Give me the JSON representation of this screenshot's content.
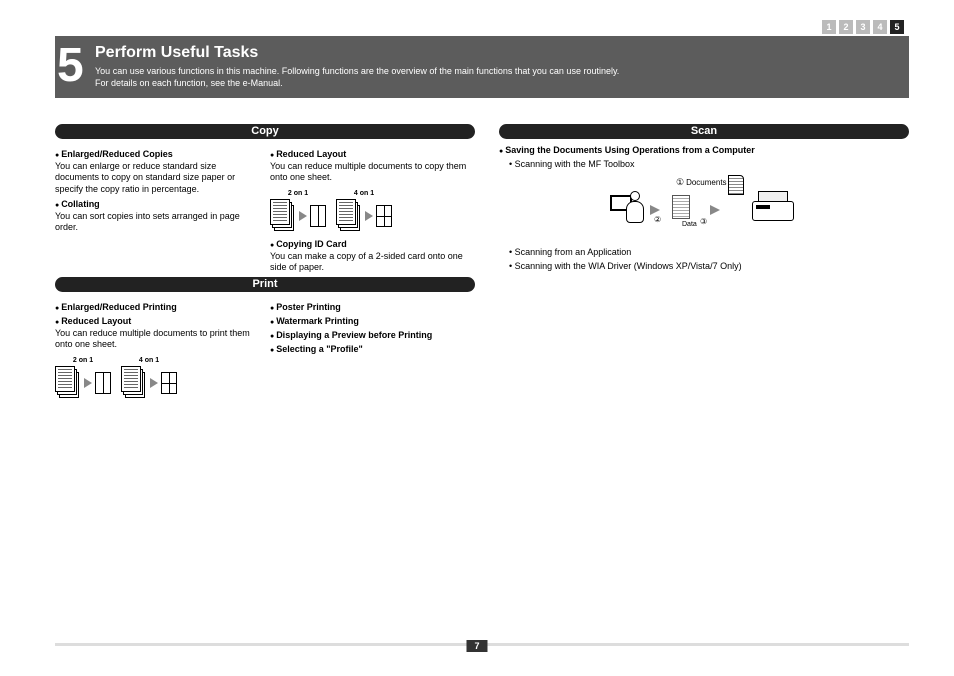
{
  "nav": {
    "pages": [
      "1",
      "2",
      "3",
      "4",
      "5"
    ],
    "active": "5"
  },
  "language": "English",
  "chapter": "5",
  "title": "Perform Useful Tasks",
  "subtitle1": "You can use various functions in this machine. Following functions are the overview of the main functions that you can use routinely.",
  "subtitle2": "For details on each function, see the e-Manual.",
  "copy": {
    "heading": "Copy",
    "left": {
      "f1": "Enlarged/Reduced Copies",
      "d1": "You can enlarge or reduce standard size documents to copy on standard size paper or specify the copy ratio in percentage.",
      "f2": "Collating",
      "d2": "You can sort copies into sets arranged in page order."
    },
    "right": {
      "f1": "Reduced Layout",
      "d1": "You can reduce multiple documents to copy them onto one sheet.",
      "labA": "2 on 1",
      "labB": "4 on 1",
      "f2": "Copying ID Card",
      "d2": "You can make a copy of a 2-sided card onto one side of paper."
    }
  },
  "print": {
    "heading": "Print",
    "left": {
      "f1": "Enlarged/Reduced Printing",
      "f2": "Reduced Layout",
      "d2": "You can reduce multiple documents to print them onto one sheet.",
      "labA": "2 on 1",
      "labB": "4 on 1"
    },
    "right": {
      "f1": "Poster Printing",
      "f2": "Watermark Printing",
      "f3": "Displaying a Preview before Printing",
      "f4": "Selecting a \"Profile\""
    }
  },
  "scan": {
    "heading": "Scan",
    "f1": "Saving the Documents Using Operations from a Computer",
    "b1": "Scanning with the MF Toolbox",
    "diag": {
      "doc": "Documents",
      "data": "Data"
    },
    "b2": "Scanning from an Application",
    "b3": "Scanning with the WIA Driver (Windows XP/Vista/7 Only)"
  },
  "pageNumber": "7"
}
